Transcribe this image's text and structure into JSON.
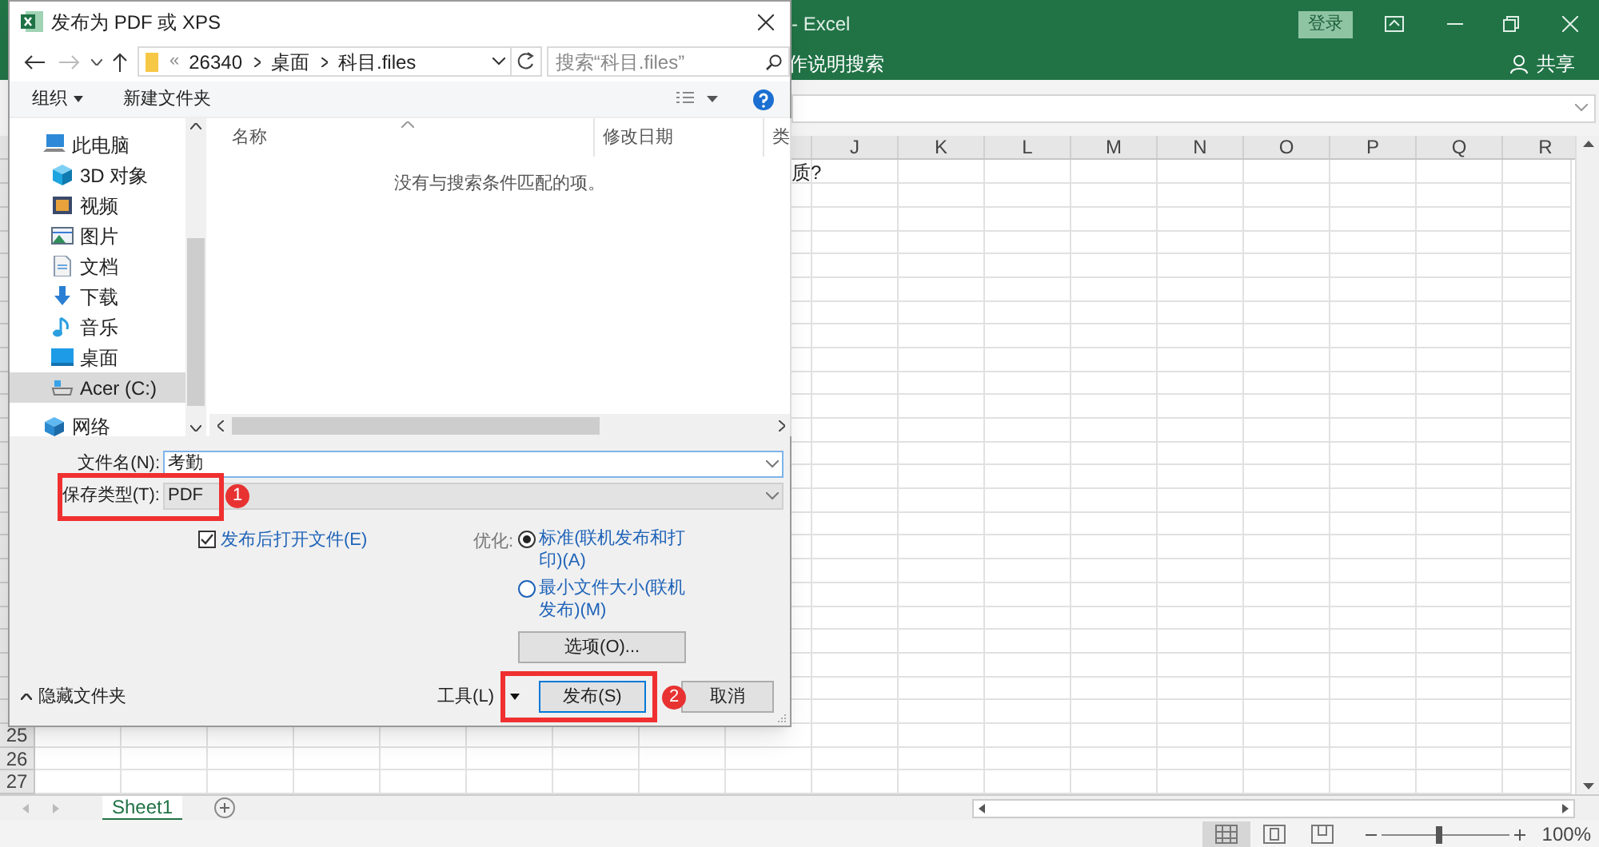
{
  "excel": {
    "title": "- Excel",
    "sign_in": "登录",
    "tell_me": "作说明搜索",
    "share": "共享",
    "columns": [
      "J",
      "K",
      "L",
      "M",
      "N",
      "O",
      "P",
      "Q",
      "R"
    ],
    "cell_text": "质?",
    "row_numbers": [
      "25",
      "26",
      "27"
    ],
    "sheets": [
      {
        "label": "Sheet1",
        "selected": true
      }
    ],
    "views": [
      {
        "kind": "normal",
        "selected": true
      },
      {
        "kind": "page_layout",
        "selected": false
      },
      {
        "kind": "page_break",
        "selected": false
      }
    ],
    "zoom": {
      "level": 0.45,
      "reading": "100%"
    }
  },
  "dialog": {
    "title": "发布为 PDF 或 XPS",
    "overflow_marker": "«",
    "breadcrumb": [
      "26340",
      "桌面",
      "科目.files"
    ],
    "search": {
      "placeholder": "搜索“科目.files”"
    },
    "toolbar": [
      "组织",
      "新建文件夹"
    ],
    "nav": [
      {
        "label": "此电脑",
        "kind": "pc",
        "selected": false,
        "children": [
          {
            "label": "3D 对象",
            "kind": "cube",
            "selected": false
          },
          {
            "label": "视频",
            "kind": "video",
            "selected": false
          },
          {
            "label": "图片",
            "kind": "picture",
            "selected": false
          },
          {
            "label": "文档",
            "kind": "document",
            "selected": false
          },
          {
            "label": "下载",
            "kind": "download",
            "selected": false
          },
          {
            "label": "音乐",
            "kind": "music",
            "selected": false
          },
          {
            "label": "桌面",
            "kind": "desktop",
            "selected": false
          },
          {
            "label": "Acer (C:)",
            "kind": "drive",
            "selected": true
          }
        ]
      },
      {
        "label": "网络",
        "kind": "network",
        "selected": false
      }
    ],
    "columns": [
      "名称",
      "修改日期",
      "类"
    ],
    "empty_message": "没有与搜索条件匹配的项。",
    "file_name": {
      "label": "文件名(N):",
      "value": "考勤"
    },
    "save_type": {
      "label": "保存类型(T):",
      "value": "PDF"
    },
    "open_after": {
      "label": "发布后打开文件(E)",
      "checked": true
    },
    "optimize": {
      "label": "优化:",
      "options": [
        {
          "label": "标准(联机发布和打印)(A)",
          "selected": true
        },
        {
          "label": "最小文件大小(联机发布)(M)",
          "selected": false
        }
      ]
    },
    "options_button": "选项(O)...",
    "hide_folders": "隐藏文件夹",
    "tools": "工具(L)",
    "publish": "发布(S)",
    "cancel": "取消"
  },
  "annotations": [
    {
      "label": "1"
    },
    {
      "label": "2"
    }
  ]
}
